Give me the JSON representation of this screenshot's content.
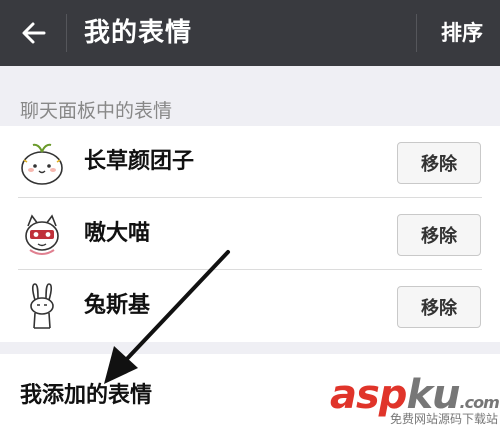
{
  "header": {
    "title": "我的表情",
    "sort_label": "排序",
    "back_icon": "arrow-left-icon",
    "bg_color": "#393a3f"
  },
  "panel_section": {
    "label": "聊天面板中的表情",
    "items": [
      {
        "name": "长草颜团子",
        "remove_label": "移除",
        "icon": "sprout-bun-sticker"
      },
      {
        "name": "嗷大喵",
        "remove_label": "移除",
        "icon": "cat-sticker"
      },
      {
        "name": "兔斯基",
        "remove_label": "移除",
        "icon": "rabbit-sticker"
      }
    ]
  },
  "added_section": {
    "label": "我添加的表情"
  },
  "watermark": {
    "brand_a": "asp",
    "brand_b": "ku",
    "brand_suffix": ".com",
    "subtitle": "免费网站源码下载站",
    "accent_color": "#e0342a"
  }
}
